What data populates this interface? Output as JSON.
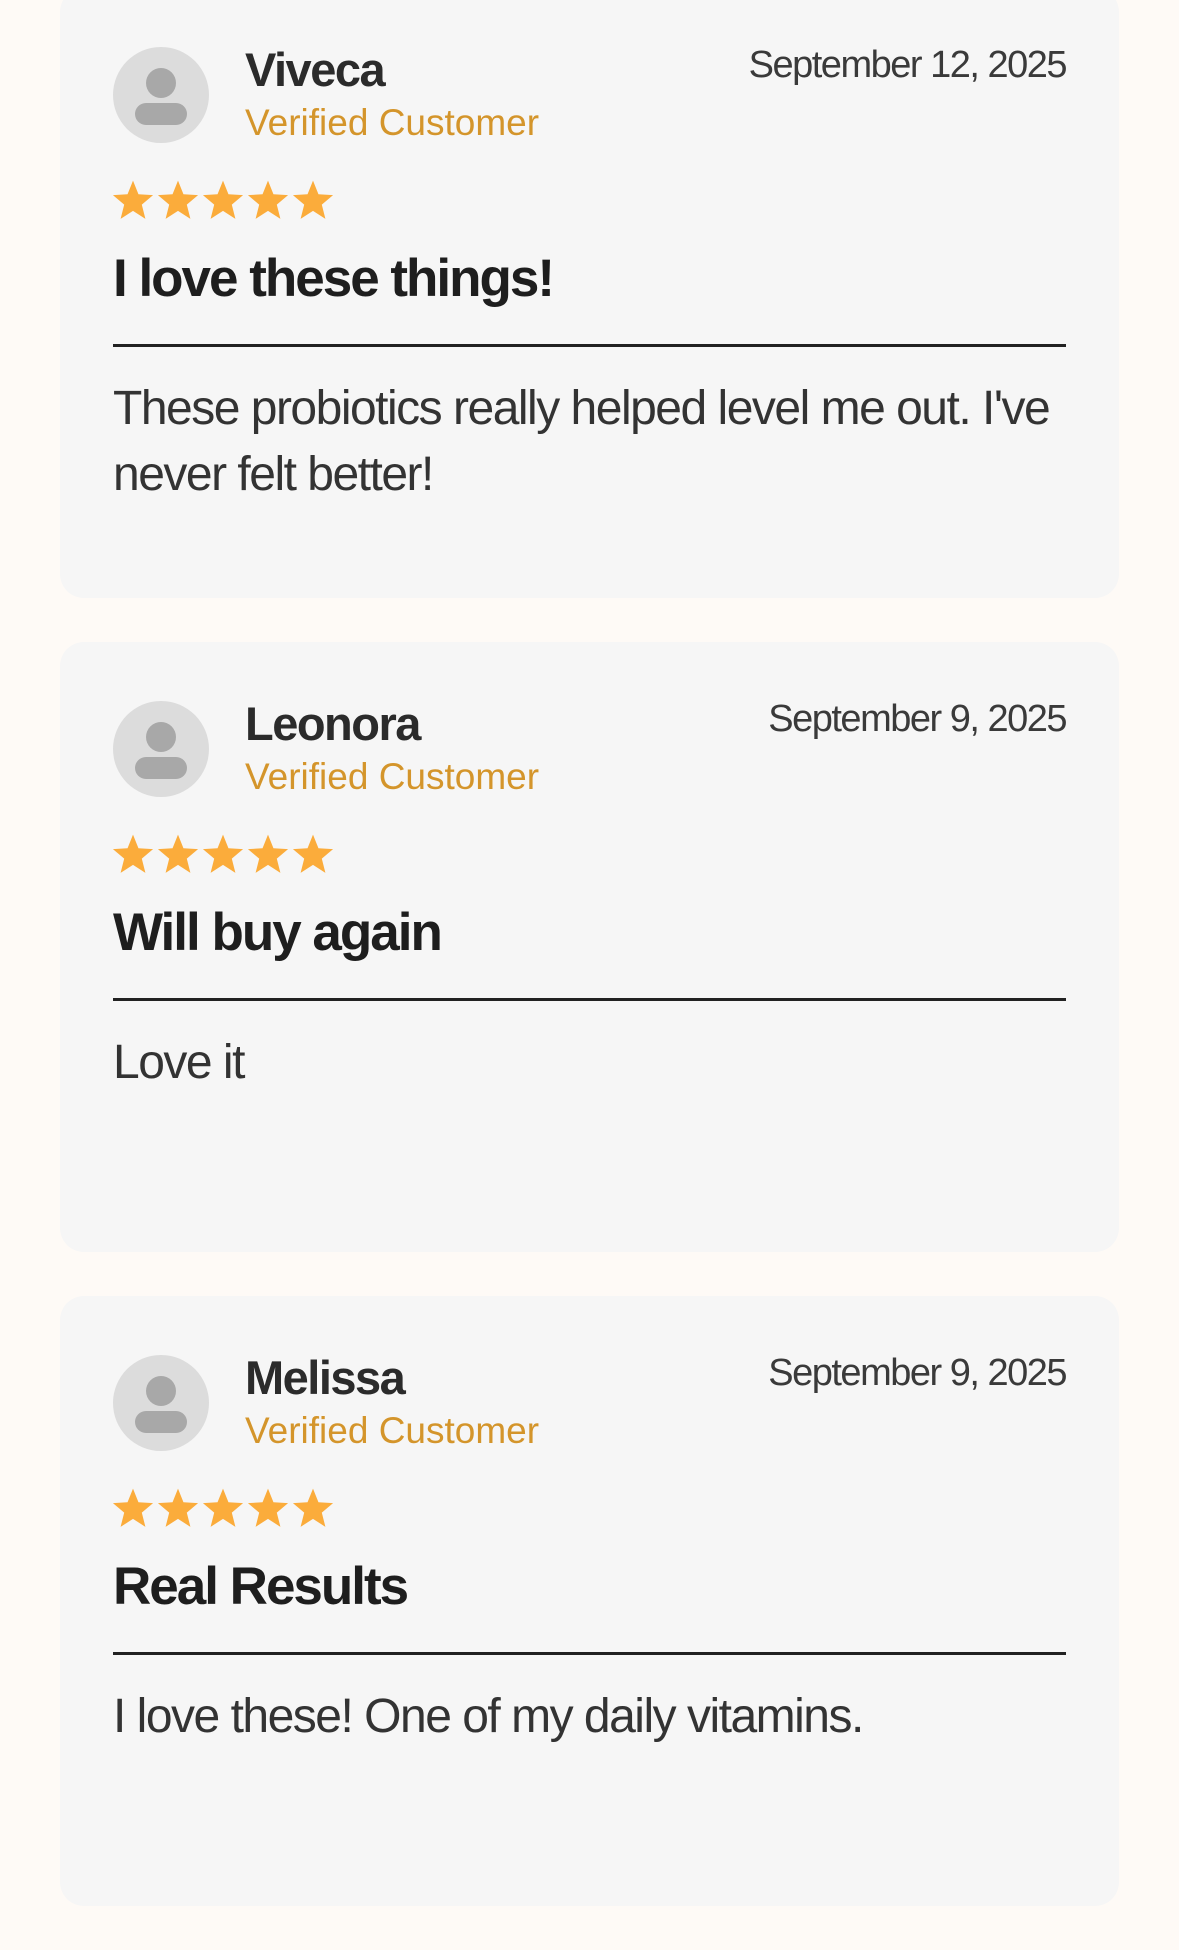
{
  "reviews": [
    {
      "name": "Viveca",
      "badge": "Verified Customer",
      "date": "September 12, 2025",
      "rating": 5,
      "title": "I love these things!",
      "body": "These probiotics really helped level me out. I've never felt better!"
    },
    {
      "name": "Leonora",
      "badge": "Verified Customer",
      "date": "September 9, 2025",
      "rating": 5,
      "title": "Will buy again",
      "body": "Love it"
    },
    {
      "name": "Melissa",
      "badge": "Verified Customer",
      "date": "September 9, 2025",
      "rating": 5,
      "title": "Real Results",
      "body": "I love these! One of my daily vitamins."
    }
  ],
  "colors": {
    "page_background": "#fefaf6",
    "card_background": "#f6f6f6",
    "star": "#fbac3b",
    "verified_text": "#d4952b",
    "avatar_background": "#dcdcdc",
    "avatar_figure": "#a8a8a8"
  },
  "icons": {
    "avatar": "person-placeholder-icon",
    "rating": "star-icon"
  }
}
